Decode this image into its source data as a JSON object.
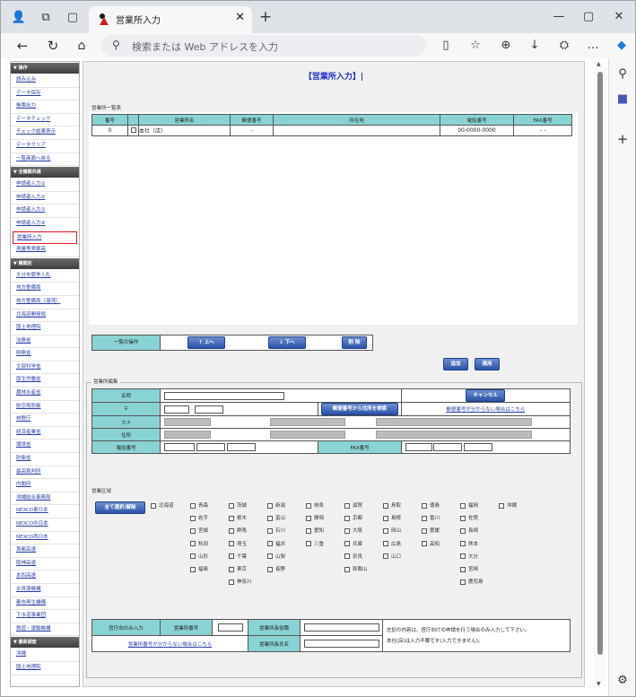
{
  "browser": {
    "tab_title": "営業所入力",
    "address_placeholder": "検索または Web アドレスを入力"
  },
  "sidebar": {
    "sections": [
      {
        "title": "▼ 操作",
        "items": [
          "読み込み",
          "データ保存",
          "帳票出力",
          "データチェック",
          "チェック結果表示",
          "データクリア",
          "一覧画面へ戻る"
        ]
      },
      {
        "title": "▼ 全機関共通",
        "items": [
          "申請者入力①",
          "申請者入力②",
          "申請者入力③",
          "申請者入力④",
          "営業所入力",
          "測量等実績高"
        ]
      },
      {
        "title": "▼ 機関別",
        "items": [
          "大分市競争入札",
          "地方整備局",
          "地方整備局（港湾）",
          "北海道開発局",
          "国土地理院",
          "法務省",
          "財務省",
          "文部科学省",
          "厚生労働省",
          "農林水産省",
          "航空局防衛",
          "林野庁",
          "経済産業省",
          "環境省",
          "防衛省",
          "最高裁判所",
          "内閣府",
          "沖縄総合事務局",
          "NEXCO東日本",
          "NEXCO中日本",
          "NEXCO西日本",
          "首都高速",
          "阪神高速",
          "本四高速",
          "水資源機構",
          "都市再生機構",
          "下水道事業団",
          "鉄道・運輸機構"
        ]
      },
      {
        "title": "▼ 最新調査",
        "items": [
          "沖縄",
          "国土地理院"
        ]
      }
    ]
  },
  "main": {
    "title": "【営業所入力】|",
    "list_caption": "営業所一覧表",
    "list_headers": [
      "番号",
      "",
      "営業所名",
      "郵便番号",
      "所在地",
      "電話番号",
      "FAX番号"
    ],
    "list_rows": [
      [
        "0",
        "",
        "本社（店）",
        "-",
        "",
        "00-0000-0000",
        "- -"
      ]
    ],
    "ops_label": "一覧の操作",
    "btn_up": "↑ 上へ",
    "btn_down": "↓ 下へ",
    "btn_delete": "削 除",
    "btn_add": "追加",
    "btn_apply": "適用",
    "edit_caption": "営業所編集",
    "name_label": "名称",
    "cancel": "キャンセル",
    "postal_label": "〒",
    "dash": "-",
    "postal_search": "郵便番号から住所を検索",
    "postal_unknown": "郵便番号が分からない場合はこちら",
    "kana_label": "カナ",
    "address_label": "住所",
    "phone_label": "電話番号",
    "fax_label": "FAX番号",
    "area_label": "営業区域",
    "select_all": "全て選択/解除",
    "prefectures": [
      "北海道",
      "青森",
      "岩手",
      "宮城",
      "秋田",
      "山形",
      "福島",
      "茨城",
      "栃木",
      "群馬",
      "埼玉",
      "千葉",
      "東京",
      "神奈川",
      "新潟",
      "富山",
      "石川",
      "福井",
      "山梨",
      "長野",
      "岐阜",
      "静岡",
      "愛知",
      "三重",
      "滋賀",
      "京都",
      "大阪",
      "兵庫",
      "奈良",
      "和歌山",
      "鳥取",
      "島根",
      "岡山",
      "広島",
      "山口",
      "徳島",
      "香川",
      "愛媛",
      "高知",
      "福岡",
      "佐賀",
      "長崎",
      "熊本",
      "大分",
      "宮崎",
      "鹿児島",
      "沖縄"
    ],
    "gov_only": "官庁向のみ入力",
    "office_no": "営業所番号",
    "office_unknown": "営業所番号が分からない場合はこちら",
    "manager_title": "営業所長役職",
    "manager_name": "営業所長氏名",
    "note1": "左記の内容は、官庁向けの申請を行う場合のみ入力して下さい。",
    "note2": "本社(店)は入力不要です(入力できません)。"
  }
}
